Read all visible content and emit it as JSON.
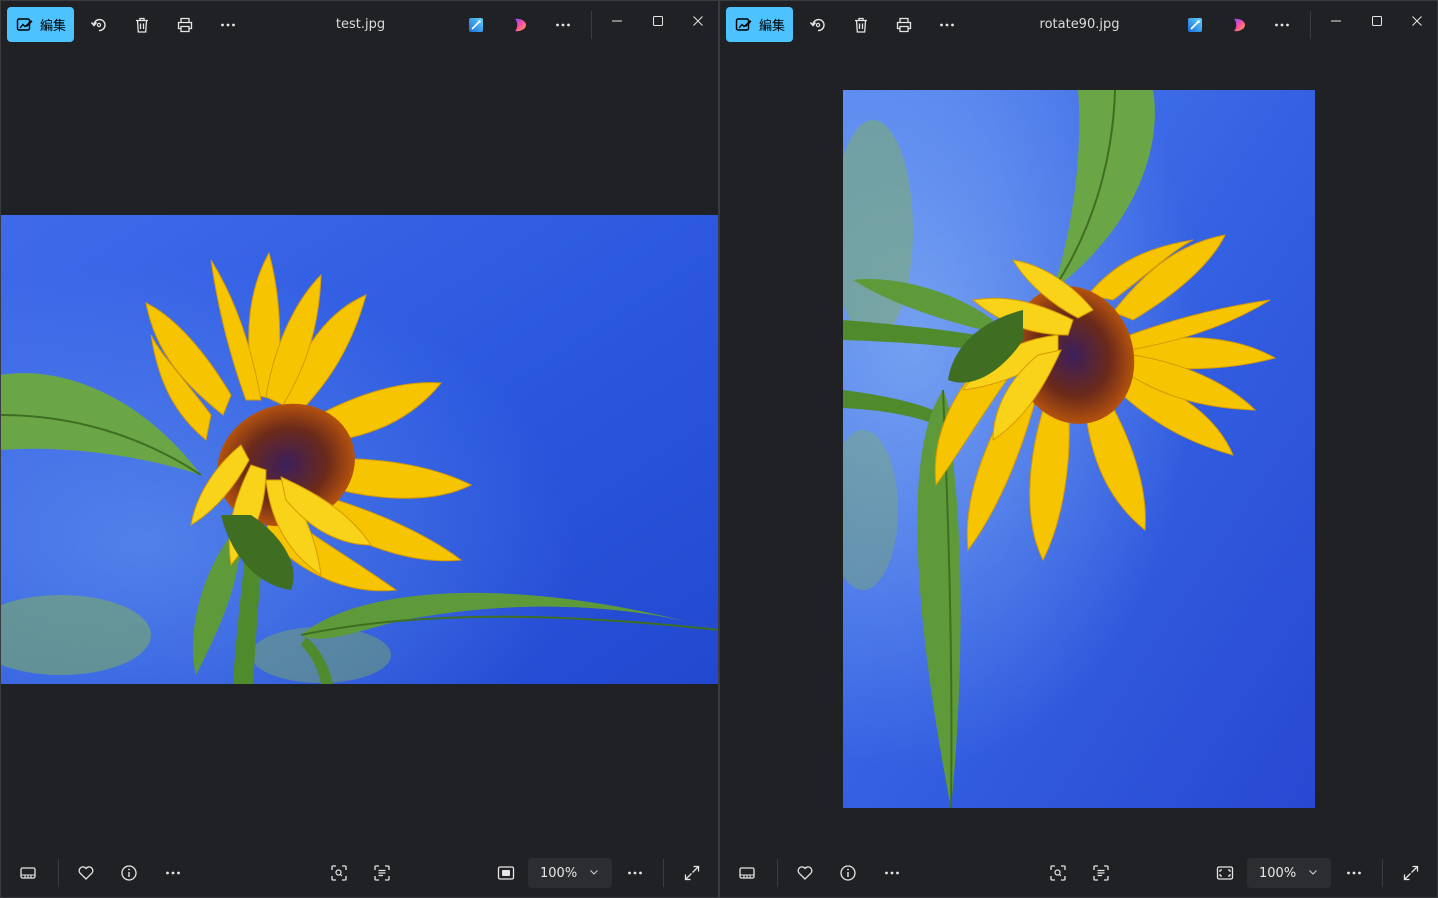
{
  "windows": [
    {
      "title": "test.jpg",
      "edit_label": "編集",
      "zoom": "100%"
    },
    {
      "title": "rotate90.jpg",
      "edit_label": "編集",
      "zoom": "100%"
    }
  ],
  "icons": {
    "edit": "edit-image-icon",
    "rotate": "rotate-icon",
    "delete": "trash-icon",
    "print": "print-icon",
    "more": "more-icon",
    "designer": "designer-icon",
    "copilot": "copilot-icon",
    "minimize": "minimize-icon",
    "maximize": "maximize-icon",
    "close": "close-icon",
    "filmstrip": "filmstrip-icon",
    "favorite": "heart-icon",
    "info": "info-icon",
    "visual_search": "visual-search-icon",
    "text_scan": "text-scan-icon",
    "fit": "fit-to-window-icon",
    "fullscreen": "fullscreen-icon"
  },
  "colors": {
    "accent": "#4cc2ff",
    "window_bg": "#202124",
    "sky": "#2f5ee0",
    "petal": "#f6c400",
    "leaf": "#5f9a3a"
  }
}
